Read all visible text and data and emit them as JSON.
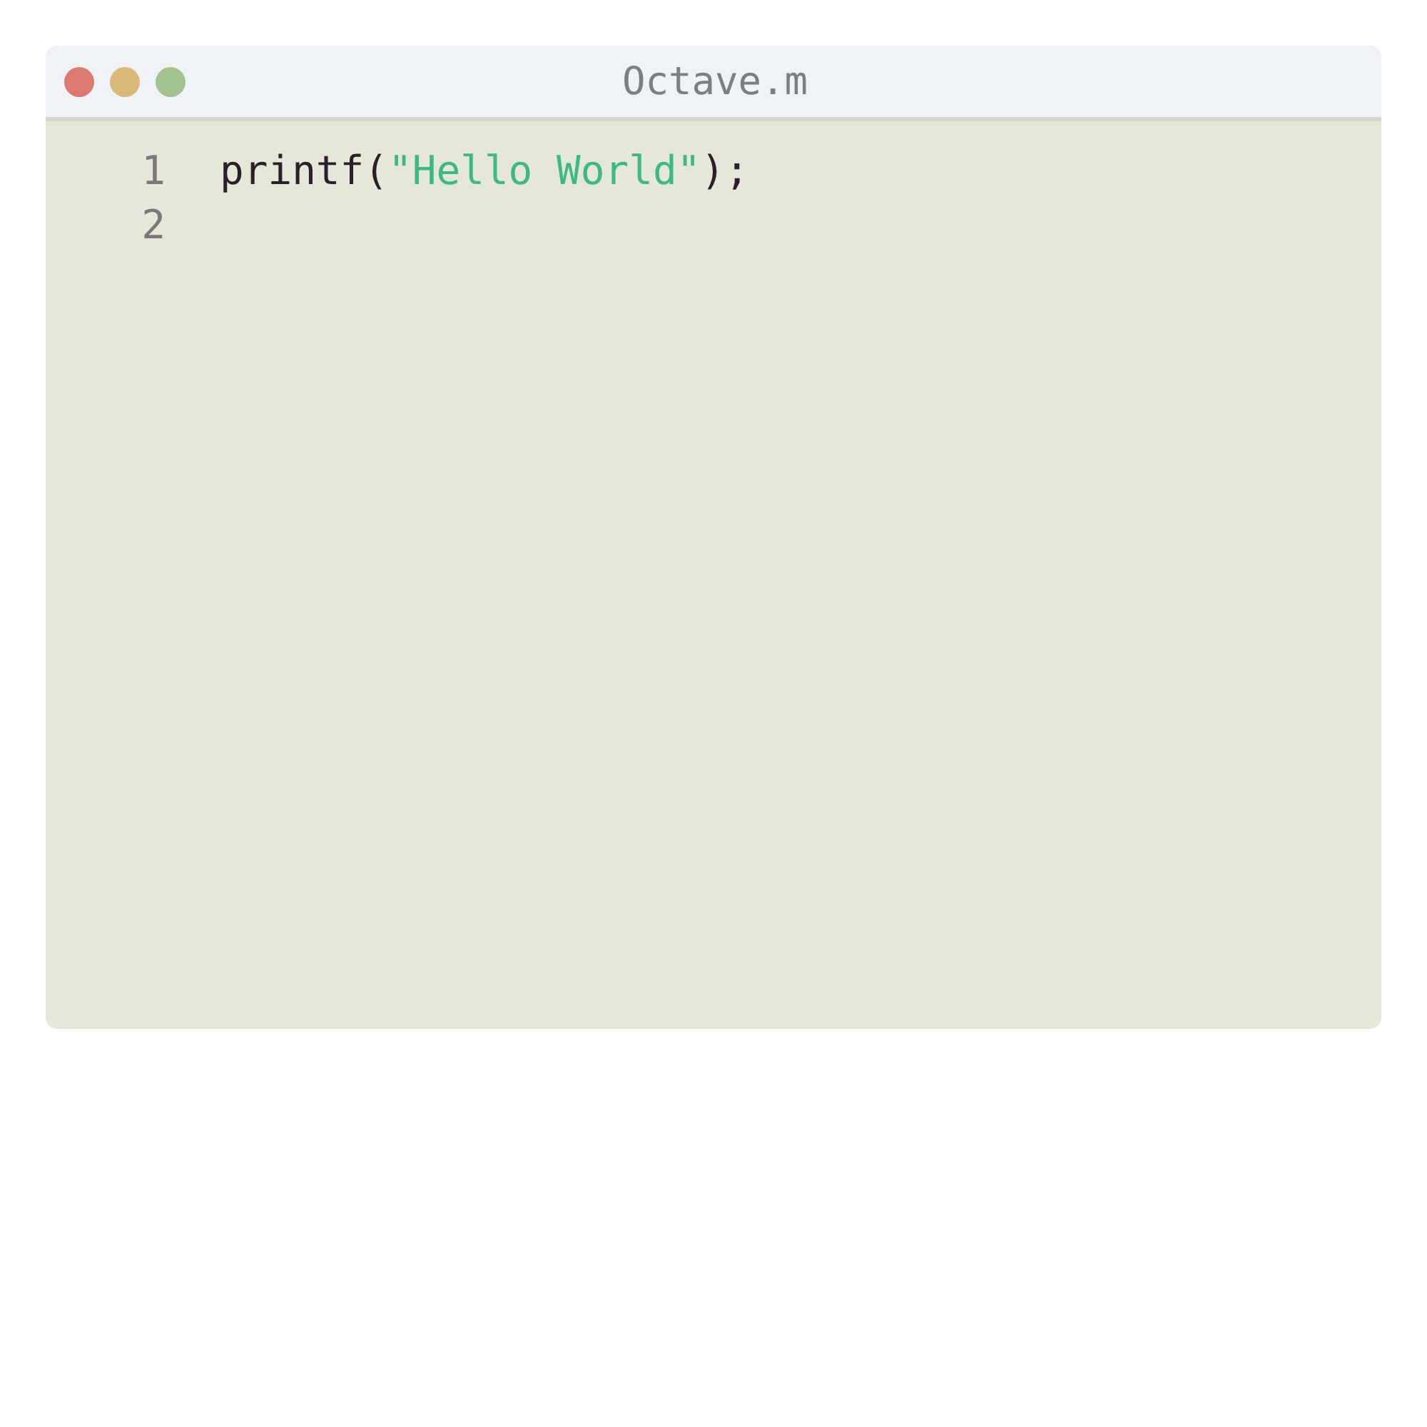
{
  "window": {
    "title": "Octave.m"
  },
  "traffic_lights": [
    {
      "color": "#dc7a72"
    },
    {
      "color": "#d9b878"
    },
    {
      "color": "#a4c290"
    }
  ],
  "editor": {
    "lines": [
      {
        "number": "1",
        "tokens": [
          {
            "kind": "plain",
            "text": "printf("
          },
          {
            "kind": "string",
            "text": "\"Hello World\""
          },
          {
            "kind": "plain",
            "text": ");"
          }
        ]
      },
      {
        "number": "2"
      }
    ]
  }
}
